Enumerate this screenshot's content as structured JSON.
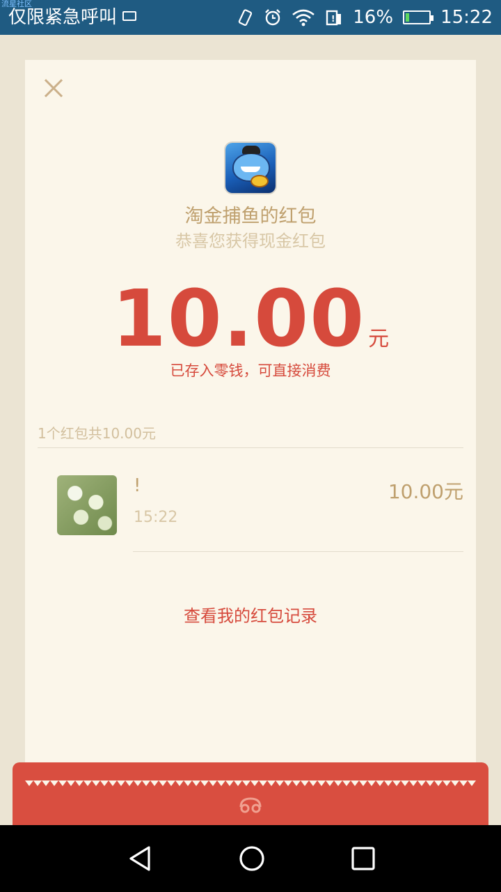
{
  "status_bar": {
    "watermark": "流星社区",
    "carrier": "仅限紧急呼叫",
    "battery": "16%",
    "battery_level": 0.16,
    "time": "15:22"
  },
  "card": {
    "title": "淘金捕鱼的红包",
    "subtitle": "恭喜您获得现金红包",
    "amount": "10.00",
    "unit": "元",
    "saved_note": "已存入零钱，可直接消费",
    "summary": "1个红包共10.00元",
    "records": [
      {
        "name": "!",
        "time": "15:22",
        "amount": "10.00元"
      }
    ],
    "view_records_label": "查看我的红包记录"
  },
  "colors": {
    "status_bar": "#1f5b82",
    "accent_red": "#d64a3c",
    "gold_text": "#bfa06e",
    "card_bg": "#fbf6ea",
    "page_bg": "#ebe4d3"
  },
  "icons": [
    "close-icon",
    "app-icon",
    "back-icon",
    "home-icon",
    "recents-icon",
    "wifi-icon",
    "alarm-icon",
    "battery-icon"
  ]
}
